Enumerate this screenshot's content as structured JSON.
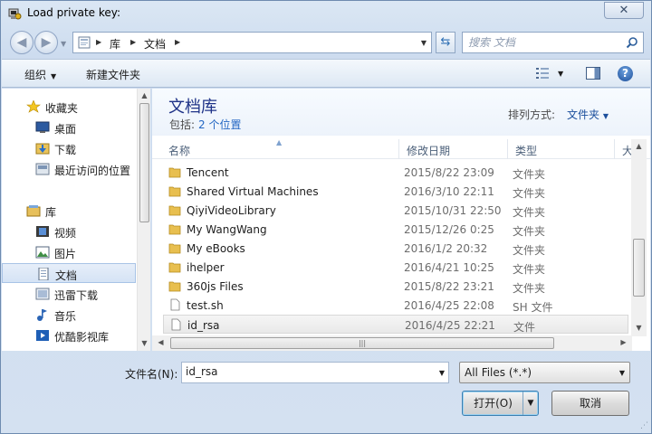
{
  "window": {
    "title": "Load private key:",
    "close_label": "✕"
  },
  "address": {
    "crumbs": [
      "库",
      "文档"
    ],
    "search_placeholder": "搜索 文档"
  },
  "toolbar": {
    "organize_label": "组织",
    "new_folder_label": "新建文件夹",
    "help_label": "?"
  },
  "sidebar": {
    "items": [
      {
        "label": "收藏夹",
        "icon": "star-icon"
      },
      {
        "label": "桌面",
        "icon": "desktop-icon"
      },
      {
        "label": "下载",
        "icon": "download-folder-icon"
      },
      {
        "label": "最近访问的位置",
        "icon": "recent-places-icon"
      },
      {
        "label": "库",
        "icon": "library-icon"
      },
      {
        "label": "视频",
        "icon": "video-library-icon"
      },
      {
        "label": "图片",
        "icon": "pictures-library-icon"
      },
      {
        "label": "文档",
        "icon": "documents-library-icon"
      },
      {
        "label": "迅雷下载",
        "icon": "thunder-download-icon"
      },
      {
        "label": "音乐",
        "icon": "music-library-icon"
      },
      {
        "label": "优酷影视库",
        "icon": "youku-library-icon"
      }
    ]
  },
  "library": {
    "title": "文档库",
    "includes_label": "包括:",
    "includes_link": "2 个位置",
    "arrange_label": "排列方式:",
    "arrange_value": "文件夹"
  },
  "columns": {
    "name": "名称",
    "date": "修改日期",
    "type": "类型",
    "size": "大"
  },
  "files": [
    {
      "name": "Tencent",
      "date": "2015/8/22 23:09",
      "type": "文件夹",
      "kind": "folder"
    },
    {
      "name": "Shared Virtual Machines",
      "date": "2016/3/10 22:11",
      "type": "文件夹",
      "kind": "folder"
    },
    {
      "name": "QiyiVideoLibrary",
      "date": "2015/10/31 22:50",
      "type": "文件夹",
      "kind": "folder"
    },
    {
      "name": "My WangWang",
      "date": "2015/12/26 0:25",
      "type": "文件夹",
      "kind": "folder"
    },
    {
      "name": "My eBooks",
      "date": "2016/1/2 20:32",
      "type": "文件夹",
      "kind": "folder"
    },
    {
      "name": "ihelper",
      "date": "2016/4/21 10:25",
      "type": "文件夹",
      "kind": "folder"
    },
    {
      "name": "360js Files",
      "date": "2015/8/22 23:21",
      "type": "文件夹",
      "kind": "folder"
    },
    {
      "name": "test.sh",
      "date": "2016/4/25 22:08",
      "type": "SH 文件",
      "kind": "file"
    },
    {
      "name": "id_rsa",
      "date": "2016/4/25 22:21",
      "type": "文件",
      "kind": "file"
    }
  ],
  "bottom": {
    "filename_label": "文件名(N):",
    "filename_value": "id_rsa",
    "filter_value": "All Files (*.*)",
    "open_label": "打开(O)",
    "cancel_label": "取消"
  }
}
